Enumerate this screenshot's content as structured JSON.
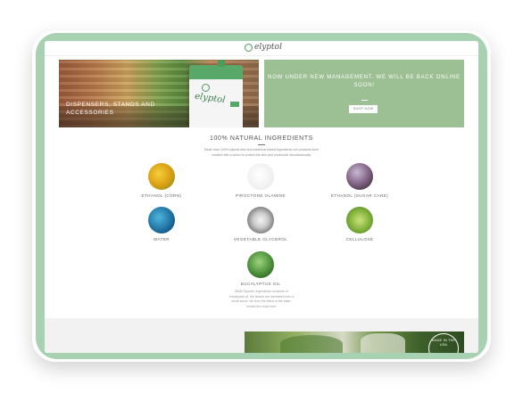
{
  "header": {
    "logo_text": "elyptol"
  },
  "hero": {
    "left_label": "DISPENSERS, STANDS AND ACCESSORIES",
    "kiosk_brand": "elyptol",
    "right_text": "NOW UNDER NEW MANAGEMENT. WE WILL BE BACK ONLINE SOON!",
    "shop_button": "SHOP NOW"
  },
  "ingredients_section": {
    "title": "100% NATURAL INGREDIENTS",
    "description": "Made from 100% natural skin and botanical-based ingredients our products were created with a vision to protect the skin and moisturize simultaneously.",
    "items": [
      {
        "label": "ETHANOL (CORN)",
        "icon": "corn-icon"
      },
      {
        "label": "PIROCTONE OLAMINE",
        "icon": "powder-icon"
      },
      {
        "label": "ETHANOL (SUGAR CANE)",
        "icon": "sugar-cane-icon"
      },
      {
        "label": "WATER",
        "icon": "water-icon"
      },
      {
        "label": "VEGETABLE GLYCEROL",
        "icon": "glycerol-icon"
      },
      {
        "label": "CELLULOSE",
        "icon": "leaf-icon"
      },
      {
        "label": "EUCALYPTUS OIL",
        "icon": "eucalyptus-icon"
      }
    ],
    "eucalyptus_desc": "While Elyptol's ingredients comprise of eucalyptus oil, the leaves are harvested from a small shrub, we form the blend of the base, extract the major tree."
  },
  "bottom": {
    "badge_text": "MADE IN THE USA"
  },
  "colors": {
    "frame": "#a7d1b0",
    "hero_panel": "#9cbf93",
    "brand_green": "#4c9a5c"
  }
}
